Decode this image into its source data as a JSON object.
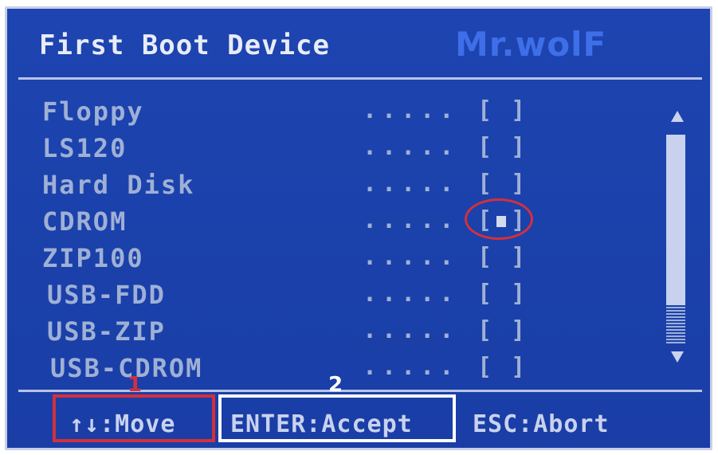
{
  "header": {
    "title": "First Boot Device",
    "watermark": "Mr.wolF"
  },
  "devices": [
    {
      "label": "Floppy",
      "dots": ".....",
      "selected": false
    },
    {
      "label": "LS120",
      "dots": ".....",
      "selected": false
    },
    {
      "label": "Hard Disk",
      "dots": ".....",
      "selected": false
    },
    {
      "label": "CDROM",
      "dots": ".....",
      "selected": true
    },
    {
      "label": "ZIP100",
      "dots": ".....",
      "selected": false
    },
    {
      "label": "USB-FDD",
      "dots": ".....",
      "selected": false
    },
    {
      "label": "USB-ZIP",
      "dots": ".....",
      "selected": false
    },
    {
      "label": "USB-CDROM",
      "dots": ".....",
      "selected": false
    }
  ],
  "footer": {
    "move": "↑↓:Move",
    "accept": "ENTER:Accept",
    "abort": "ESC:Abort"
  },
  "annotations": {
    "number_1": "1",
    "number_2": "2"
  },
  "colors": {
    "background": "#1b41ab",
    "text": "#9fb0d6",
    "highlight_red": "#d4303b",
    "highlight_white": "#ffffff"
  }
}
